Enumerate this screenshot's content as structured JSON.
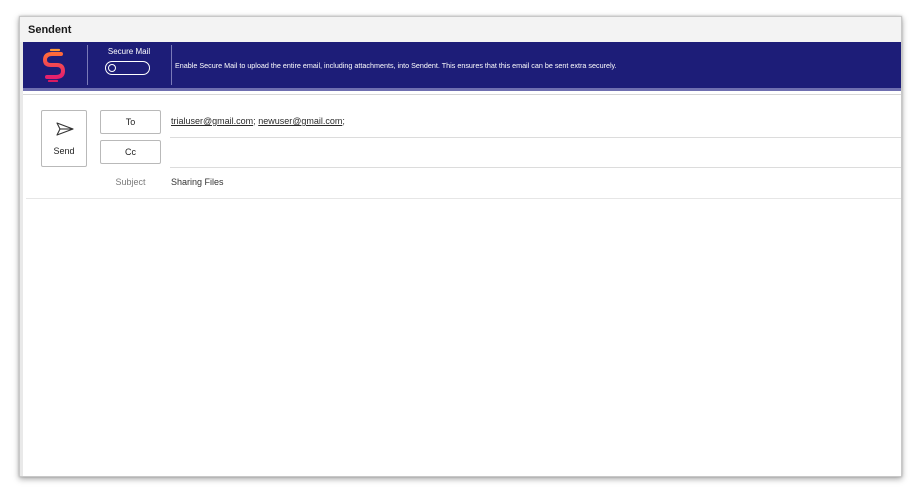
{
  "window": {
    "title": "Sendent"
  },
  "banner": {
    "secure_mail_label": "Secure Mail",
    "secure_mail_enabled": false,
    "message": "Enable Secure Mail to upload the entire email, including attachments, into Sendent. This ensures that this email can be sent extra securely.",
    "logo_icon": "sendent-logo-icon",
    "colors": {
      "background": "#1d1d78",
      "logo_top": "#ff5a3c",
      "logo_bottom": "#e51f6e"
    }
  },
  "compose": {
    "send_label": "Send",
    "send_icon": "send-arrow-icon",
    "to_label": "To",
    "cc_label": "Cc",
    "recipients": [
      {
        "address": "trialuser@gmail.com",
        "sep": ";"
      },
      {
        "address": "newuser@gmail.com",
        "sep": ";"
      }
    ],
    "cc_value": "",
    "subject_label": "Subject",
    "subject_value": "Sharing Files",
    "body": ""
  }
}
